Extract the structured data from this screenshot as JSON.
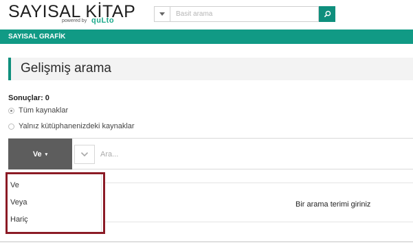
{
  "logo": {
    "title": "SAYISAL KİTAP",
    "powered_by": "powered by",
    "brand": "quLto"
  },
  "search": {
    "placeholder": "Basit arama",
    "caret_icon": "caret-down-icon",
    "button_icon": "search-icon"
  },
  "nav": {
    "label": "SAYISAL GRAFİK"
  },
  "page": {
    "heading": "Gelişmiş arama",
    "results_label": "Sonuçlar: 0"
  },
  "scope": {
    "options": [
      {
        "label": "Tüm kaynaklar",
        "checked": true
      },
      {
        "label": "Yalnız kütüphanenizdeki kaynaklar",
        "checked": false
      }
    ]
  },
  "query": {
    "operator_label": "Ve",
    "operator_caret": "▾",
    "search_placeholder": "Ara..."
  },
  "dropdown": {
    "items": [
      "Ve",
      "Veya",
      "Hariç"
    ]
  },
  "results": {
    "empty_message": "Bir arama terimi giriniz"
  },
  "colors": {
    "brand_green": "#119a85",
    "button_dark": "#5d5d5d",
    "highlight_border": "#8b1a25"
  }
}
